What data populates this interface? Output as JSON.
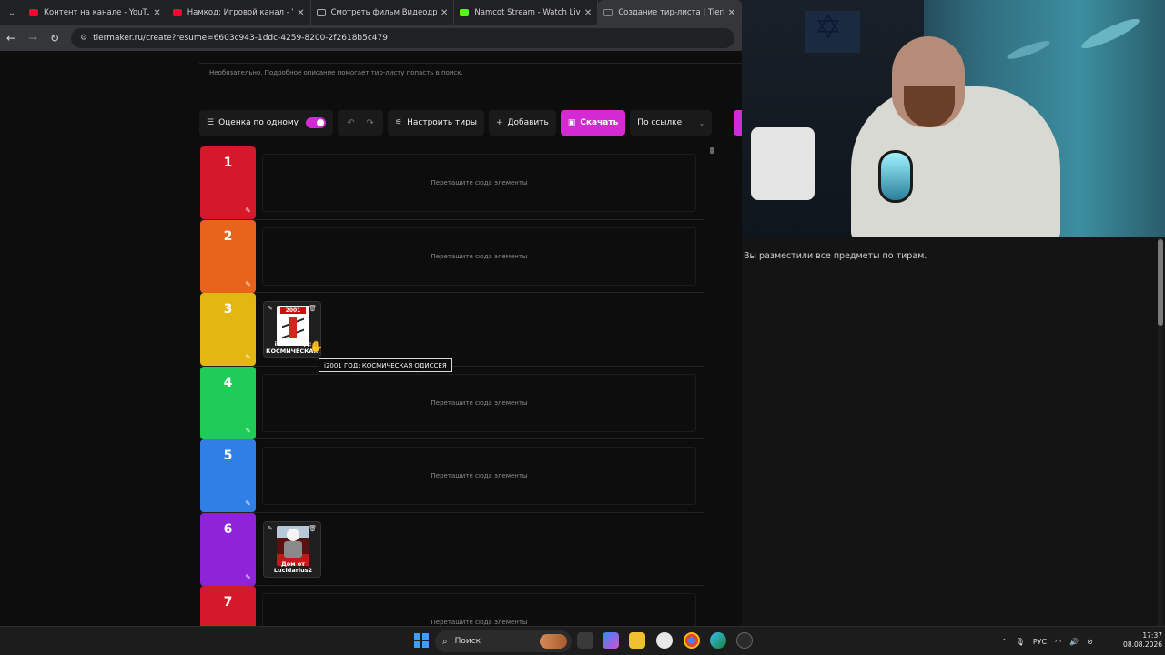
{
  "browser": {
    "tabs": [
      {
        "label": "Контент на канале - YouTube S",
        "favicon": "youtube-icon",
        "active": false
      },
      {
        "label": "Намкод: Игровой канал - YouT",
        "favicon": "youtube-icon",
        "active": false
      },
      {
        "label": "Смотреть фильм Видеодром",
        "favicon": "page-icon",
        "active": false
      },
      {
        "label": "Namcot Stream - Watch Live on",
        "favicon": "kick-icon",
        "active": false
      },
      {
        "label": "Создание тир-листа | TierMak",
        "favicon": "tiermaker-icon",
        "active": true
      }
    ],
    "url": "tiermaker.ru/create?resume=6603c943-1ddc-4259-8200-2f2618b5c479"
  },
  "page": {
    "hint": "Необязательно. Подробное описание помогает тир-листу попасть в поиск.",
    "toolbar": {
      "rate_one_label": "Оценка по одному",
      "rate_one_on": true,
      "configure_tiers_label": "Настроить тиры",
      "add_label": "Добавить",
      "download_label": "Скачать",
      "share_select_label": "По ссылке"
    },
    "empty_drop_text": "Перетащите сюда элементы",
    "tiers": [
      {
        "label": "1",
        "color": "#d5192b",
        "items": []
      },
      {
        "label": "2",
        "color": "#e8631c",
        "items": []
      },
      {
        "label": "3",
        "color": "#e3b612",
        "items": [
          {
            "caption": "i2001 ГОД: КОСМИЧЕСКА..."
          }
        ]
      },
      {
        "label": "4",
        "color": "#1ecc57",
        "items": []
      },
      {
        "label": "5",
        "color": "#2f7fe6",
        "items": []
      },
      {
        "label": "6",
        "color": "#8f23d8",
        "items": [
          {
            "caption": "Дом от Lucidarius2"
          }
        ]
      },
      {
        "label": "7",
        "color": "#d5192b",
        "items": []
      }
    ],
    "tooltip": "i2001 ГОД: КОСМИЧЕСКАЯ ОДИССЕЯ"
  },
  "right_panel": {
    "status_text": "Вы разместили все предметы по тирам."
  },
  "taskbar": {
    "search_label": "Поиск",
    "language": "РУС",
    "time": "17:37",
    "date": "08.08.2026"
  }
}
